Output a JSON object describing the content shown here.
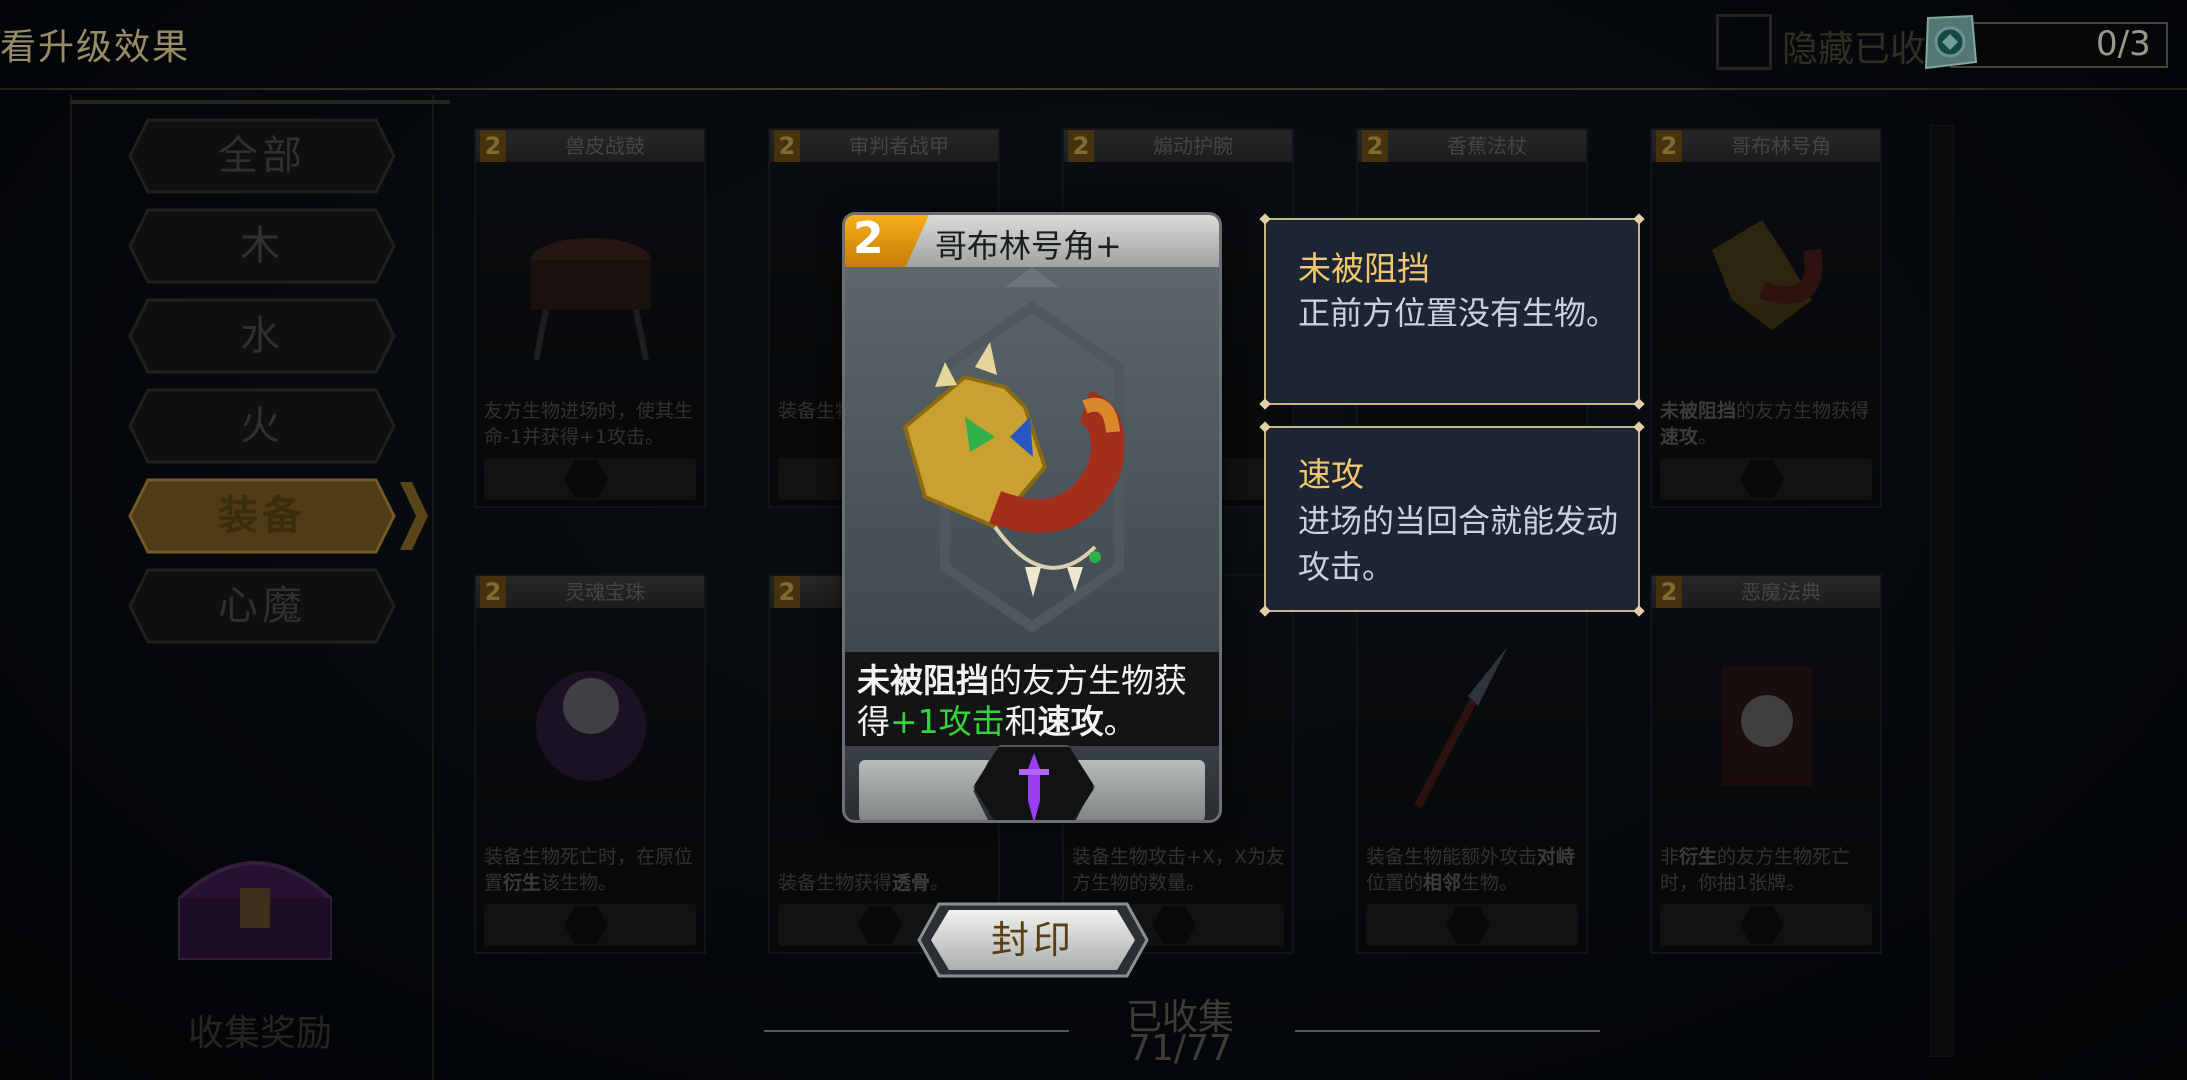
{
  "header": {
    "title": "看升级效果",
    "hide_label": "隐藏已收",
    "progress": "0/3"
  },
  "sidebar": {
    "items": [
      {
        "label": "全部",
        "active": false
      },
      {
        "label": "木",
        "active": false
      },
      {
        "label": "水",
        "active": false
      },
      {
        "label": "火",
        "active": false
      },
      {
        "label": "装备",
        "active": true
      },
      {
        "label": "心魔",
        "active": false
      }
    ],
    "reward_label": "收集奖励"
  },
  "cards": [
    {
      "cost": "2",
      "name": "兽皮战鼓",
      "desc": "友方生物进场时，使其生命-1并获得+1攻击。"
    },
    {
      "cost": "2",
      "name": "审判者战甲",
      "desc": "装备生物…使对手…"
    },
    {
      "cost": "2",
      "name": "煽动护腕",
      "desc": "…其相…击，直…"
    },
    {
      "cost": "2",
      "name": "香蕉法杖",
      "desc": ""
    },
    {
      "cost": "2",
      "name": "哥布林号角",
      "desc_bold": "未被阻挡",
      "desc": "的友方生物获得",
      "desc_bold2": "速攻",
      "desc_end": "。"
    },
    {
      "cost": "2",
      "name": "灵魂宝珠",
      "desc": "装备生物死亡时，在原位置",
      "desc_bold": "衍生",
      "desc_end": "该生物。"
    },
    {
      "cost": "2",
      "name": "",
      "desc": "装备生物获得",
      "desc_bold": "透骨",
      "desc_end": "。"
    },
    {
      "cost": "",
      "name": "",
      "desc": "装备生物攻击+X，X为友方生物的数量。"
    },
    {
      "cost": "",
      "name": "",
      "desc": "装备生物能额外攻击",
      "desc_bold": "对峙",
      "desc_mid": "位置的",
      "desc_bold2": "相邻",
      "desc_end": "生物。"
    },
    {
      "cost": "2",
      "name": "恶魔法典",
      "desc": "非",
      "desc_bold": "衍生",
      "desc_end": "的友方生物死亡时，你抽1张牌。"
    }
  ],
  "featured_card": {
    "cost": "2",
    "name": "哥布林号角+",
    "desc_bold1": "未被阻挡",
    "desc_part1": "的友方生物获得",
    "desc_green": "+1攻击",
    "desc_part2": "和",
    "desc_bold2": "速攻",
    "desc_end": "。"
  },
  "tooltips": [
    {
      "title": "未被阻挡",
      "text": "正前方位置没有生物。"
    },
    {
      "title": "速攻",
      "text": "进场的当回合就能发动攻击。"
    }
  ],
  "seal_button": "封印",
  "collected": {
    "label": "已收集",
    "count": "71/77"
  },
  "colors": {
    "accent_gold": "#f1c76a",
    "green": "#37d23a",
    "purple": "#9b3df0",
    "tooltip_bg": "#1d2434"
  },
  "icons": [
    "token-icon",
    "treasure-chest-icon",
    "dagger-icon",
    "helmet-icon"
  ]
}
